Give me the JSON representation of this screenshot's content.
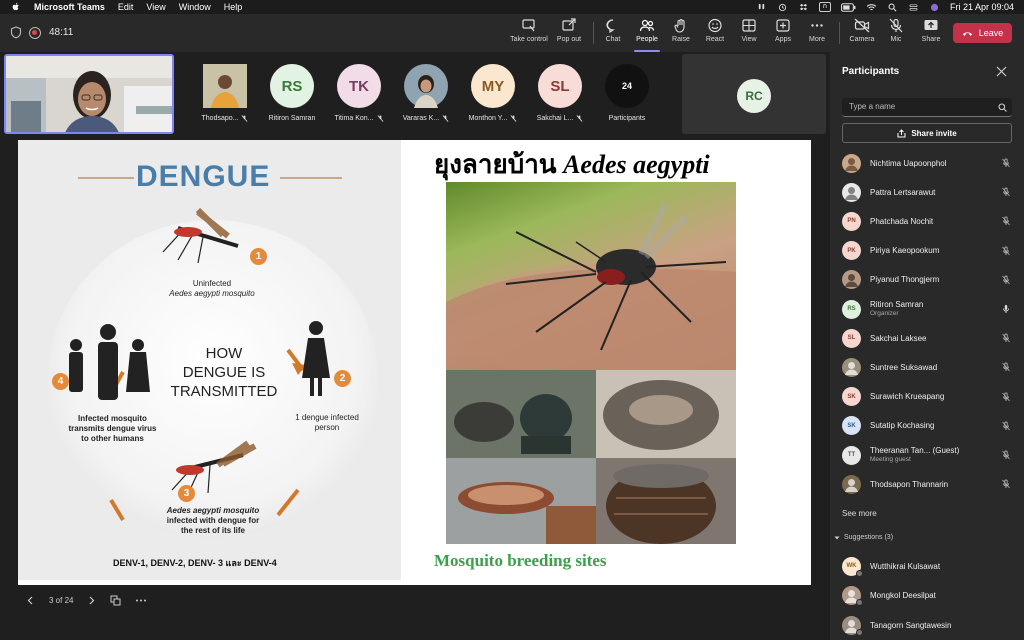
{
  "mac_menu": {
    "app_name": "Microsoft Teams",
    "items": [
      "Edit",
      "View",
      "Window",
      "Help"
    ],
    "input_badge": "ก",
    "clock": "Fri 21 Apr  09:04"
  },
  "meeting": {
    "timer": "48:11",
    "toolbar": {
      "take_control": "Take control",
      "pop_out": "Pop out",
      "chat": "Chat",
      "people": "People",
      "raise": "Raise",
      "react": "React",
      "view": "View",
      "apps": "Apps",
      "more": "More",
      "camera": "Camera",
      "mic": "Mic",
      "share": "Share",
      "leave": "Leave"
    },
    "participant_tiles": [
      {
        "name": "Thodsapo...",
        "initials": "",
        "type": "photo"
      },
      {
        "name": "Ritiron Samran",
        "initials": "RS",
        "bg": "#e3f3e3",
        "fg": "#3b7a3b"
      },
      {
        "name": "Titima Kon...",
        "initials": "TK",
        "bg": "#f1dce8",
        "fg": "#7a3a5e"
      },
      {
        "name": "Vararas K...",
        "initials": "",
        "type": "photo"
      },
      {
        "name": "Monthon Y...",
        "initials": "MY",
        "bg": "#fbe7cf",
        "fg": "#8a5a1e"
      },
      {
        "name": "Sakchai L...",
        "initials": "SL",
        "bg": "#f7dcd8",
        "fg": "#8a3b33"
      }
    ],
    "participants_count": "24",
    "participants_label": "Participants",
    "rc_tile_initials": "RC"
  },
  "slide": {
    "dengue_title": "DENGUE",
    "how_text": [
      "HOW",
      "DENGUE IS",
      "TRANSMITTED"
    ],
    "step1": [
      "Uninfected",
      "Aedes aegypti mosquito"
    ],
    "step2": [
      "1 dengue infected",
      "person"
    ],
    "step3": [
      "Aedes aegypti mosquito",
      "infected with dengue for",
      "the rest of its life"
    ],
    "step4": [
      "Infected mosquito",
      "transmits dengue virus",
      "to other humans"
    ],
    "numbers": [
      "1",
      "2",
      "3",
      "4"
    ],
    "denv": "DENV-1, DENV-2, DENV- 3 และ DENV-4",
    "thai_title": "ยุงลายบ้าน",
    "latin_title": "Aedes aegypti",
    "breeding_caption": "Mosquito breeding sites",
    "page_indicator": "3 of 24"
  },
  "panel": {
    "title": "Participants",
    "search_placeholder": "Type a name",
    "share_invite": "Share invite",
    "people": [
      {
        "name": "Nichtima Uapoonphol",
        "initials": "",
        "bg": "#c9a98c",
        "fg": "#5a3a22",
        "mic": "muted"
      },
      {
        "name": "Pattra Lertsarawut",
        "initials": "",
        "bg": "#e8e8e8",
        "fg": "#555",
        "mic": "muted"
      },
      {
        "name": "Phatchada Nochit",
        "initials": "PN",
        "bg": "#f6d7d0",
        "fg": "#8a3b33",
        "mic": "muted"
      },
      {
        "name": "Piriya Kaeopookum",
        "initials": "PK",
        "bg": "#f6d7d0",
        "fg": "#8a3b33",
        "mic": "muted"
      },
      {
        "name": "Piyanud Thongjerm",
        "initials": "",
        "bg": "#b49a86",
        "fg": "#3a2a1e",
        "mic": "muted"
      },
      {
        "name": "Ritiron Samran",
        "sub": "Organizer",
        "initials": "RS",
        "bg": "#dff0df",
        "fg": "#3b7a3b",
        "mic": "on"
      },
      {
        "name": "Sakchai Laksee",
        "initials": "SL",
        "bg": "#f6d7d0",
        "fg": "#8a3b33",
        "mic": "muted"
      },
      {
        "name": "Suntree Suksawad",
        "initials": "",
        "bg": "#9a8f7a",
        "fg": "#fff",
        "mic": "muted"
      },
      {
        "name": "Surawich Krueapang",
        "initials": "SK",
        "bg": "#f6d7d0",
        "fg": "#8a3b33",
        "mic": "muted"
      },
      {
        "name": "Sutatip Kochasing",
        "initials": "SK",
        "bg": "#d6e4f5",
        "fg": "#2e5a8a",
        "mic": "muted"
      },
      {
        "name": "Theeranan Tan...   (Guest)",
        "sub": "Meeting guest",
        "initials": "TT",
        "bg": "#e8e8e8",
        "fg": "#555",
        "mic": "muted"
      },
      {
        "name": "Thodsapon Thannarin",
        "initials": "",
        "bg": "#7b6a50",
        "fg": "#fff",
        "mic": "muted"
      }
    ],
    "see_more": "See more",
    "suggestions_label": "Suggestions (3)",
    "suggestions": [
      {
        "name": "Wutthikrai Kulsawat",
        "initials": "WK",
        "bg": "#fbe7cf",
        "fg": "#8a5a1e"
      },
      {
        "name": "Mongkol Deesilpat",
        "initials": "",
        "bg": "#b29a8a",
        "fg": "#fff"
      },
      {
        "name": "Tanagorn Sangtawesin",
        "initials": "",
        "bg": "#9d8d80",
        "fg": "#fff"
      }
    ]
  }
}
